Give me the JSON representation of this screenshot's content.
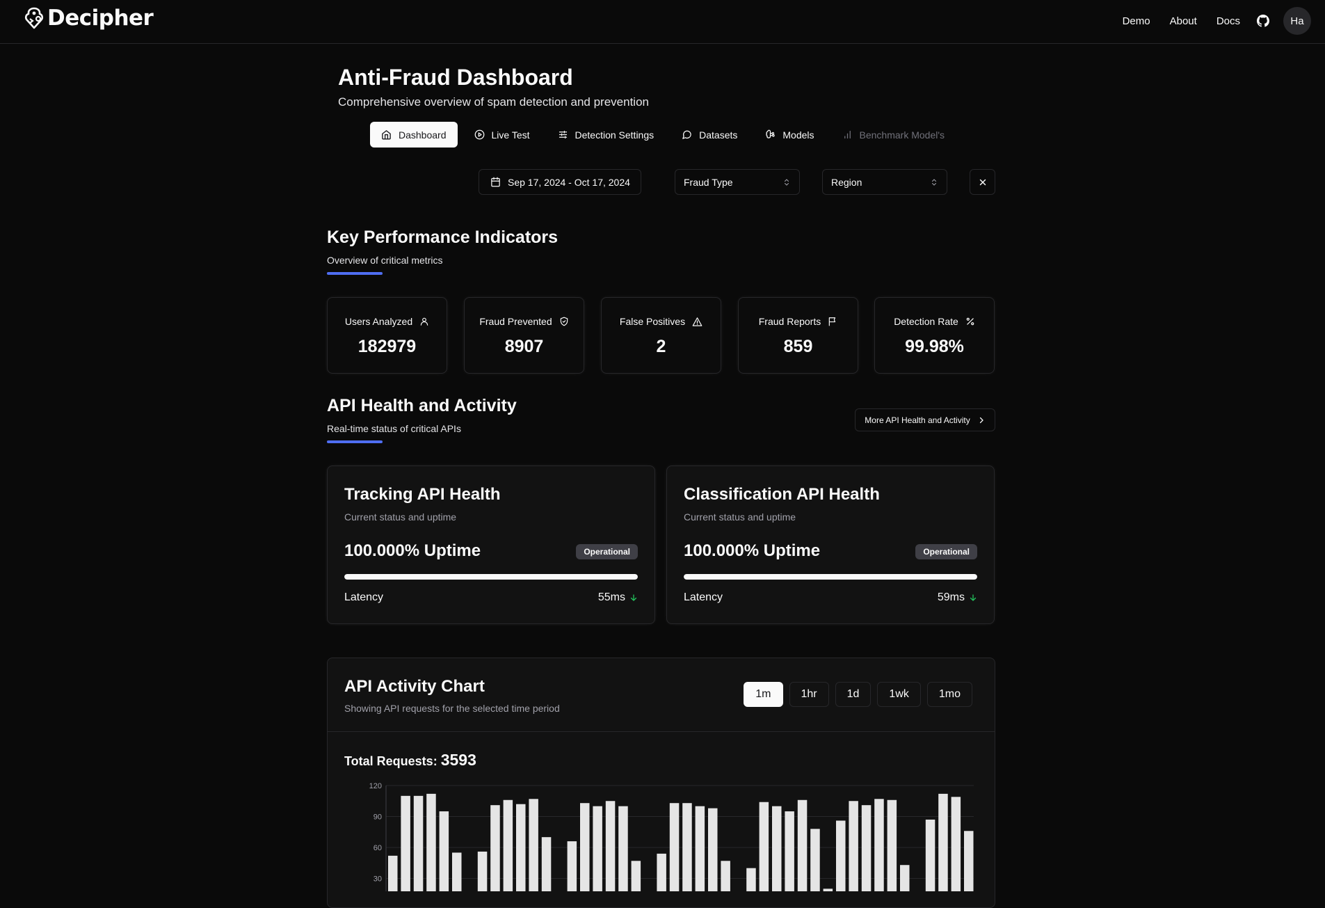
{
  "app": {
    "name": "Decipher"
  },
  "nav": {
    "links": [
      "Demo",
      "About",
      "Docs"
    ],
    "github_icon": "github-icon",
    "avatar_initials": "Ha"
  },
  "header": {
    "title": "Anti-Fraud Dashboard",
    "subtitle": "Comprehensive overview of spam detection and prevention"
  },
  "tabs": [
    {
      "label": "Dashboard",
      "icon": "home-icon",
      "active": true
    },
    {
      "label": "Live Test",
      "icon": "play-circle-icon"
    },
    {
      "label": "Detection Settings",
      "icon": "sliders-icon"
    },
    {
      "label": "Datasets",
      "icon": "message-circle-icon"
    },
    {
      "label": "Models",
      "icon": "brain-icon"
    },
    {
      "label": "Benchmark Model's",
      "icon": "bar-chart-icon",
      "disabled": true
    }
  ],
  "filters": {
    "date_range": "Sep 17, 2024 - Oct 17, 2024",
    "fraud_type": "Fraud Type",
    "region": "Region"
  },
  "kpi": {
    "title": "Key Performance Indicators",
    "subtitle": "Overview of critical metrics",
    "cards": [
      {
        "label": "Users Analyzed",
        "value": "182979",
        "icon": "user-icon"
      },
      {
        "label": "Fraud Prevented",
        "value": "8907",
        "icon": "shield-check-icon"
      },
      {
        "label": "False Positives",
        "value": "2",
        "icon": "alert-triangle-icon"
      },
      {
        "label": "Fraud Reports",
        "value": "859",
        "icon": "flag-icon"
      },
      {
        "label": "Detection Rate",
        "value": "99.98%",
        "icon": "percent-icon"
      }
    ]
  },
  "api": {
    "title": "API Health and Activity",
    "subtitle": "Real-time status of critical APIs",
    "more_label": "More API Health and Activity",
    "cards": [
      {
        "title": "Tracking API Health",
        "subtitle": "Current status and uptime",
        "uptime": "100.000% Uptime",
        "uptime_fraction": 1.0,
        "status": "Operational",
        "latency_label": "Latency",
        "latency": "55ms"
      },
      {
        "title": "Classification API Health",
        "subtitle": "Current status and uptime",
        "uptime": "100.000% Uptime",
        "uptime_fraction": 1.0,
        "status": "Operational",
        "latency_label": "Latency",
        "latency": "59ms"
      }
    ]
  },
  "activity": {
    "title": "API Activity Chart",
    "subtitle": "Showing API requests for the selected time period",
    "ranges": [
      "1m",
      "1hr",
      "1d",
      "1wk",
      "1mo"
    ],
    "active_range": "1m",
    "total_label": "Total Requests:",
    "total_value": "3593"
  },
  "colors": {
    "accent": "#4f6ef2",
    "bar": "#e5e5e5",
    "positive": "#22c55e"
  },
  "chart_data": {
    "type": "bar",
    "y_ticks": [
      30,
      60,
      90,
      120
    ],
    "ylim": [
      0,
      120
    ],
    "values": [
      52,
      110,
      110,
      112,
      95,
      55,
      null,
      56,
      101,
      106,
      102,
      107,
      70,
      null,
      66,
      103,
      100,
      105,
      100,
      47,
      null,
      54,
      103,
      103,
      100,
      98,
      47,
      null,
      40,
      104,
      100,
      95,
      106,
      78,
      20,
      86,
      105,
      101,
      107,
      106,
      43,
      null,
      87,
      112,
      109,
      76
    ]
  }
}
